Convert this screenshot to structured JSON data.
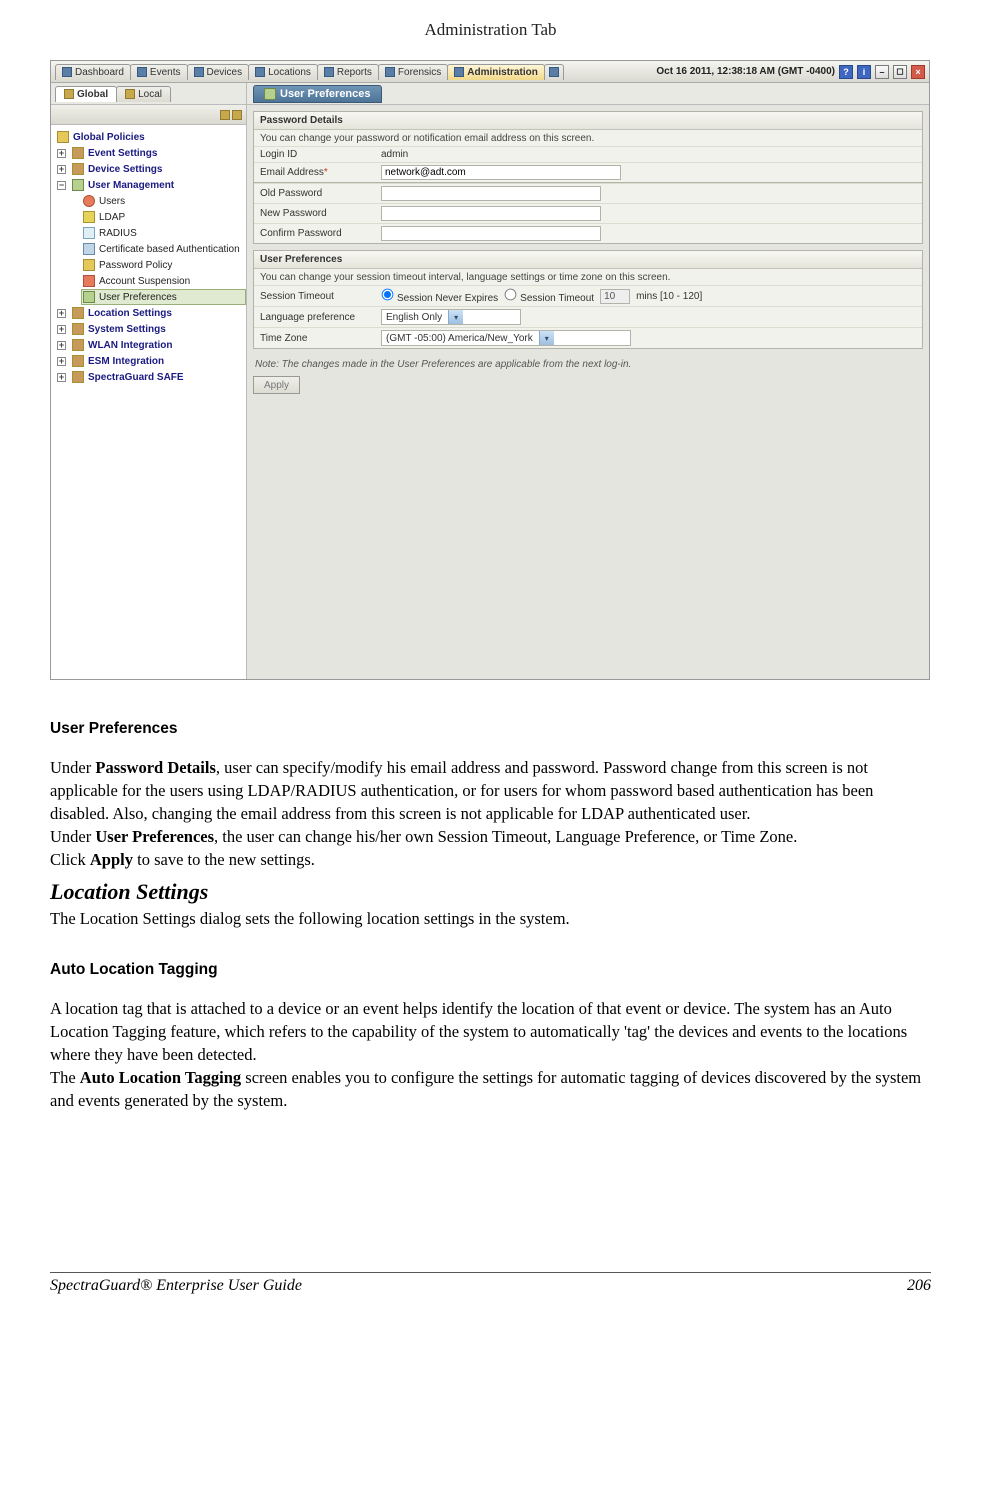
{
  "doc": {
    "header_title": "Administration Tab",
    "section_user_prefs": "User Preferences",
    "para1_a": "Under ",
    "para1_b": "Password Details",
    "para1_c": ", user can specify/modify his email address and password. Password change from this screen is not applicable for the users using  LDAP/RADIUS authentication, or for users for whom password based authentication has been disabled. Also, changing the email address from this screen is not applicable for LDAP authenticated user.",
    "para2_a": "Under ",
    "para2_b": "User Preferences",
    "para2_c": ", the user can change his/her own Session Timeout, Language Preference, or Time Zone.",
    "para3_a": "Click ",
    "para3_b": "Apply",
    "para3_c": " to save to the new settings.",
    "heading_loc": "Location Settings",
    "para4": "The Location Settings dialog sets the following location settings in the system.",
    "section_auto_tag": "Auto Location Tagging",
    "para5": "A location tag that is attached to a device or an event helps identify the location of that event or device. The system has an Auto Location Tagging feature, which refers to the capability of the system to automatically 'tag' the devices and events to the locations where they have been detected.",
    "para6_a": "The ",
    "para6_b": "Auto Location Tagging",
    "para6_c": " screen enables you to configure the settings for automatic tagging of devices discovered by the system and events generated by the system.",
    "footer_left": "SpectraGuard® Enterprise User Guide",
    "footer_right": "206"
  },
  "app": {
    "timestamp": "Oct 16 2011, 12:38:18 AM (GMT -0400)",
    "top_tabs": [
      "Dashboard",
      "Events",
      "Devices",
      "Locations",
      "Reports",
      "Forensics",
      "Administration"
    ],
    "sub_tabs": {
      "global": "Global",
      "local": "Local"
    },
    "panel_title": "User Preferences",
    "sidebar": {
      "global_policies": "Global Policies",
      "event_settings": "Event Settings",
      "device_settings": "Device Settings",
      "user_management": "User Management",
      "users": "Users",
      "ldap": "LDAP",
      "radius": "RADIUS",
      "cert_auth": "Certificate based Authentication",
      "password_policy": "Password Policy",
      "account_suspension": "Account Suspension",
      "user_preferences": "User Preferences",
      "location_settings": "Location Settings",
      "system_settings": "System Settings",
      "wlan_integration": "WLAN Integration",
      "esm_integration": "ESM Integration",
      "spectraguard_safe": "SpectraGuard SAFE"
    },
    "form": {
      "pwd_section_title": "Password Details",
      "pwd_section_desc": "You can change your password or notification email address on this screen.",
      "login_id_label": "Login ID",
      "login_id_value": "admin",
      "email_label": "Email Address",
      "email_value": "network@adt.com",
      "old_pw_label": "Old Password",
      "new_pw_label": "New Password",
      "confirm_pw_label": "Confirm Password",
      "prefs_section_title": "User Preferences",
      "prefs_section_desc": "You can change your session timeout interval, language settings or time zone on this screen.",
      "session_timeout_label": "Session Timeout",
      "session_never": "Session Never Expires",
      "session_timeout_opt": "Session Timeout",
      "session_mins_value": "10",
      "session_mins_suffix": "mins [10 - 120]",
      "lang_label": "Language preference",
      "lang_value": "English Only",
      "tz_label": "Time Zone",
      "tz_value": "(GMT -05:00)   America/New_York",
      "note": "Note: The changes made in the User Preferences are applicable from the next log-in.",
      "apply_btn": "Apply"
    }
  }
}
